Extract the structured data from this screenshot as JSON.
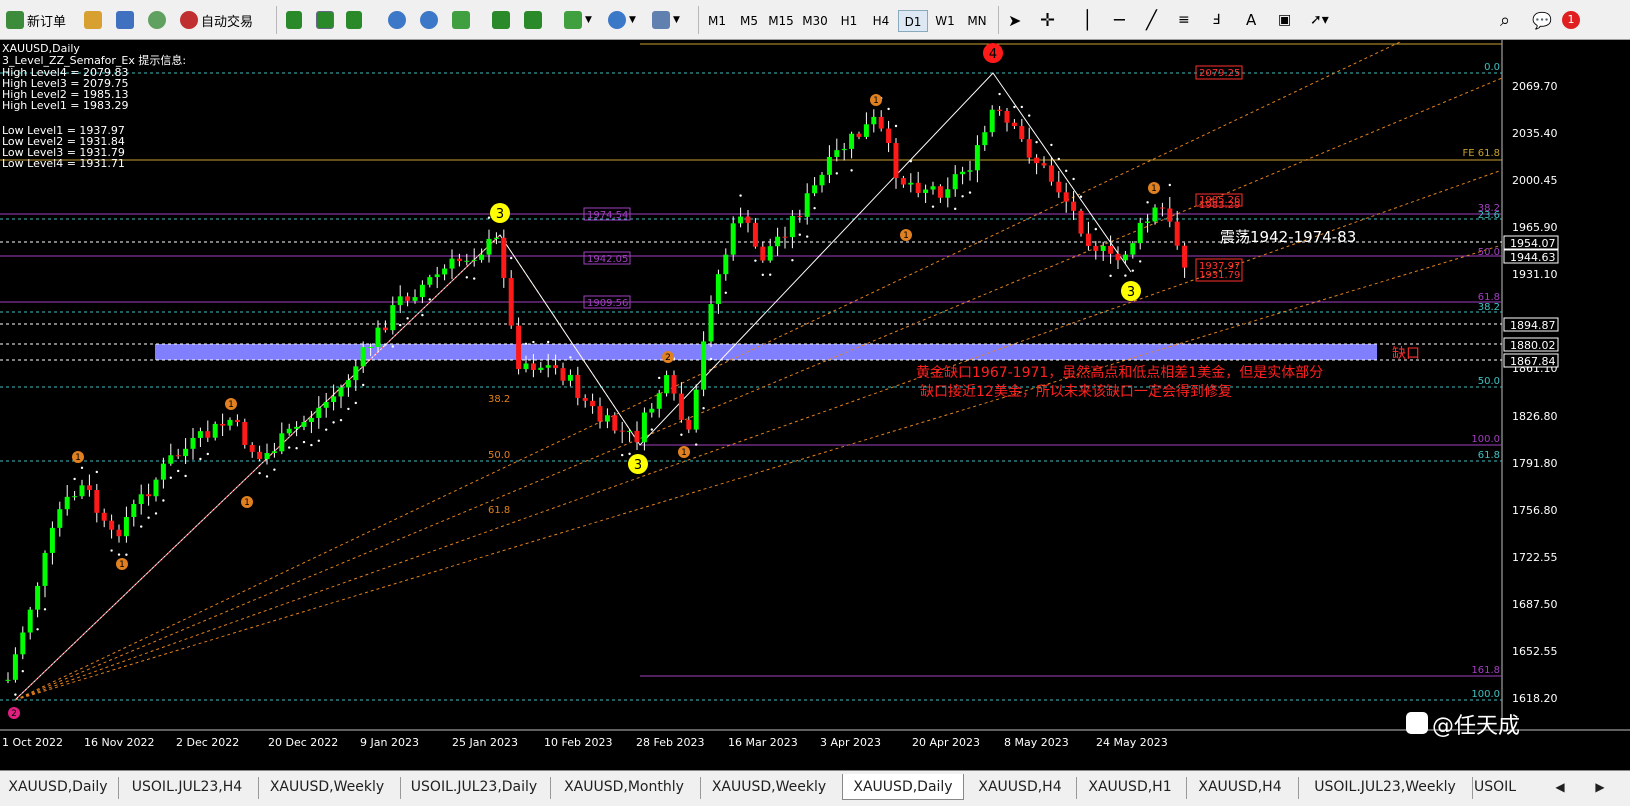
{
  "toolbar": {
    "new_order": "新订单",
    "auto_trade": "自动交易",
    "timeframes": [
      "M1",
      "M5",
      "M15",
      "M30",
      "H1",
      "H4",
      "D1",
      "W1",
      "MN"
    ],
    "active_timeframe": "D1",
    "notification_count": "1"
  },
  "chart": {
    "symbol": "XAUUSD,Daily",
    "indicator": "3_Level_ZZ_Semafor_Ex 提示信息:",
    "info_lines": [
      "High Level4 = 2079.83",
      "High Level3 = 2079.75",
      "High Level2 = 1985.13",
      "High Level1 = 1983.29",
      "",
      "Low Level1 = 1937.97",
      "Low Level2 = 1931.84",
      "Low Level3 = 1931.79",
      "Low Level4 = 1931.71"
    ],
    "price_ticks": [
      "2069.70",
      "2035.40",
      "2000.45",
      "1965.90",
      "1931.10",
      "1861.10",
      "1826.80",
      "1791.80",
      "1756.80",
      "1722.55",
      "1687.50",
      "1652.55",
      "1618.20"
    ],
    "price_boxes": [
      {
        "label": "1954.07",
        "color": "#ffffff",
        "bg": "#000000"
      },
      {
        "label": "1944.63",
        "color": "#ffffff",
        "bg": "#000000"
      },
      {
        "label": "1894.87",
        "color": "#ffffff",
        "bg": "#000000"
      },
      {
        "label": "1880.02",
        "color": "#ffffff",
        "bg": "#000000"
      },
      {
        "label": "1867.84",
        "color": "#ffffff",
        "bg": "#000000"
      }
    ],
    "date_labels": [
      "1 Oct 2022",
      "16 Nov 2022",
      "2 Dec 2022",
      "20 Dec 2022",
      "9 Jan 2023",
      "25 Jan 2023",
      "10 Feb 2023",
      "28 Feb 2023",
      "16 Mar 2023",
      "3 Apr 2023",
      "20 Apr 2023",
      "8 May 2023",
      "24 May 2023"
    ],
    "fib_right_labels": [
      "FE 61.8",
      "0.0",
      "38.2",
      "23.6",
      "50.0",
      "61.8",
      "38.2",
      "50.0",
      "100.0",
      "61.8",
      "161.8",
      "100.0"
    ],
    "fib_left_labels": [
      "38.2",
      "50.0",
      "61.8"
    ],
    "level_boxes": [
      "1974.54",
      "1942.05",
      "1909.56"
    ],
    "red_boxes": [
      "2079.25",
      "1985.26",
      "1983.29",
      "1937.97",
      "1931.79"
    ],
    "wave_labels": [
      "4",
      "3",
      "3",
      "3"
    ],
    "semafor_labels": [
      "1",
      "1",
      "1",
      "1",
      "1",
      "1",
      "1",
      "1",
      "2",
      "2"
    ],
    "range_text": "震荡1942-1974-83",
    "gap_label": "缺口",
    "note_line1": "黄金缺口1967-1971，虽然高点和低点相差1美金，但是实体部分",
    "note_line2": "缺口接近12美金，所以未来该缺口一定会得到修复",
    "watermark": "@任天成",
    "colors": {
      "bull": "#00ff00",
      "bear": "#ff1a1a",
      "gap_zone": "#8080ff",
      "fe_line": "#c8a030",
      "fib_orange": "#e08020",
      "fib_cyan": "#40c0c0",
      "fib_purple": "#a040c0"
    }
  },
  "tabs": [
    "XAUUSD,Daily",
    "USOIL.JUL23,H4",
    "XAUUSD,Weekly",
    "USOIL.JUL23,Daily",
    "XAUUSD,Monthly",
    "XAUUSD,Weekly",
    "XAUUSD,Daily",
    "XAUUSD,H4",
    "XAUUSD,H1",
    "XAUUSD,H4",
    "USOIL.JUL23,Weekly",
    "USOIL"
  ],
  "active_tab": 6
}
